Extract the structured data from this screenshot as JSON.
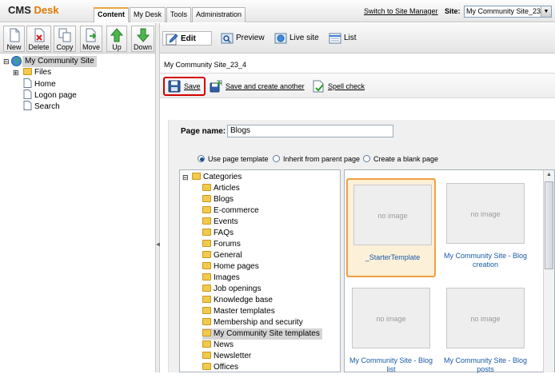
{
  "header": {
    "logo_cms": "CMS",
    "logo_desk": "Desk",
    "tabs": [
      {
        "label": "Content",
        "active": true
      },
      {
        "label": "My Desk",
        "active": false
      },
      {
        "label": "Tools",
        "active": false
      },
      {
        "label": "Administration",
        "active": false
      }
    ],
    "switch_link": "Switch to Site Manager",
    "site_label": "Site:",
    "site_value": "My Community Site_23_4"
  },
  "left_toolbar": {
    "buttons": [
      "New",
      "Delete",
      "Copy",
      "Move",
      "Up",
      "Down"
    ]
  },
  "tree": {
    "root": "My Community Site",
    "items": [
      "Files",
      "Home",
      "Logon page",
      "Search"
    ]
  },
  "modes": {
    "edit": "Edit",
    "preview": "Preview",
    "live": "Live site",
    "list": "List"
  },
  "breadcrumb": "My Community Site_23_4",
  "actions": {
    "save": "Save",
    "save_create": "Save and create another",
    "spell": "Spell check"
  },
  "form": {
    "page_name_label": "Page name:",
    "page_name_value": "Blogs",
    "radios": [
      {
        "label": "Use page template",
        "checked": true
      },
      {
        "label": "Inherit from parent page",
        "checked": false
      },
      {
        "label": "Create a blank page",
        "checked": false
      }
    ]
  },
  "categories": {
    "root": "Categories",
    "items": [
      "Articles",
      "Blogs",
      "E-commerce",
      "Events",
      "FAQs",
      "Forums",
      "General",
      "Home pages",
      "Images",
      "Job openings",
      "Knowledge base",
      "Master templates",
      "Membership and security",
      "My Community Site templates",
      "News",
      "Newsletter",
      "Offices"
    ],
    "selected": "My Community Site templates"
  },
  "templates": {
    "no_image": "no image",
    "items": [
      {
        "name": "_StarterTemplate",
        "selected": true
      },
      {
        "name": "My Community Site - Blog creation",
        "selected": false
      },
      {
        "name": "My Community Site - Blog list",
        "selected": false
      },
      {
        "name": "My Community Site - Blog posts",
        "selected": false
      }
    ]
  },
  "colors": {
    "accent": "#e07a00",
    "selected_border": "#f0a040",
    "highlight_red": "#d40000",
    "link_blue": "#1a5aa8"
  }
}
